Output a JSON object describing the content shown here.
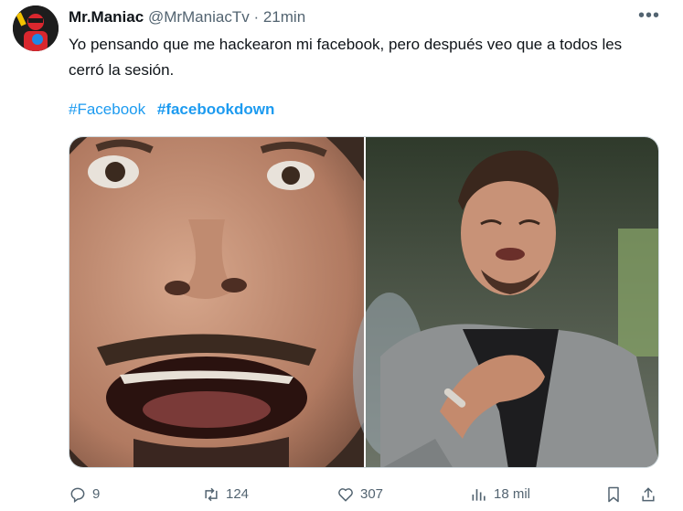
{
  "tweet": {
    "author_name": "Mr.Maniac",
    "author_handle": "@MrManiacTv",
    "separator": "·",
    "time": "21min",
    "more_label": "•••",
    "text": "Yo pensando que me hackearon mi facebook, pero después veo que a todos les cerró la sesión.",
    "hashtags": [
      "#Facebook",
      "#facebookdown"
    ]
  },
  "actions": {
    "replies": "9",
    "retweets": "124",
    "likes": "307",
    "views": "18 mil"
  },
  "colors": {
    "accent": "#1d9bf0",
    "secondary_text": "#536471",
    "primary_text": "#0f1419"
  },
  "icons": [
    "reply-icon",
    "retweet-icon",
    "like-icon",
    "views-icon",
    "bookmark-icon",
    "share-icon",
    "more-icon"
  ]
}
